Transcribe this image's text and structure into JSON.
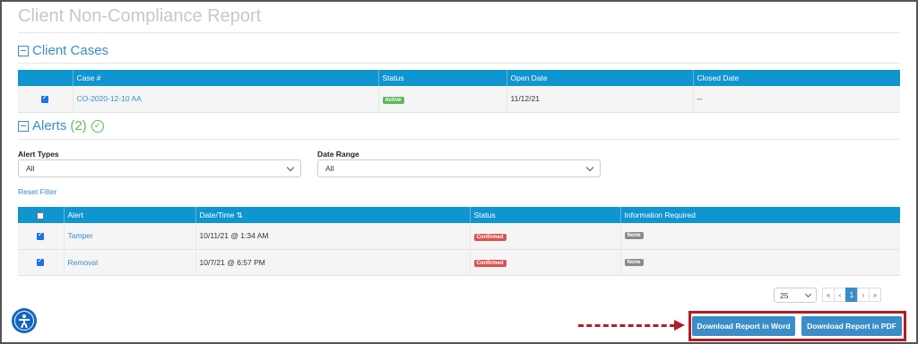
{
  "page": {
    "title": "Client Non-Compliance Report"
  },
  "client_cases": {
    "heading": "Client Cases",
    "columns": [
      "",
      "Case #",
      "Status",
      "Open Date",
      "Closed Date"
    ],
    "rows": [
      {
        "case": "CO-2020-12-10 AA",
        "status": "Active",
        "open_date": "11/12/21",
        "closed_date": "--"
      }
    ]
  },
  "alerts": {
    "heading": "Alerts",
    "count": "(2)",
    "filters": {
      "alert_types_label": "Alert Types",
      "alert_types_value": "All",
      "date_range_label": "Date Range",
      "date_range_value": "All"
    },
    "reset_label": "Reset Filter",
    "columns": [
      "",
      "Alert",
      "Date/Time",
      "Status",
      "Information Required"
    ],
    "rows": [
      {
        "alert": "Tamper",
        "datetime": "10/11/21 @ 1:34 AM",
        "status": "Confirmed",
        "info": "None"
      },
      {
        "alert": "Removal",
        "datetime": "10/7/21 @ 6:57 PM",
        "status": "Confirmed",
        "info": "None"
      }
    ]
  },
  "pagination": {
    "page_size": "25",
    "first": "«",
    "prev": "‹",
    "current": "1",
    "next": "›",
    "last": "»"
  },
  "actions": {
    "download_word": "Download Report in Word",
    "download_pdf": "Download Report in PDF"
  },
  "colors": {
    "header_blue": "#0f95cf",
    "link_blue": "#3a8dc7",
    "highlight_red": "#b01e23"
  }
}
